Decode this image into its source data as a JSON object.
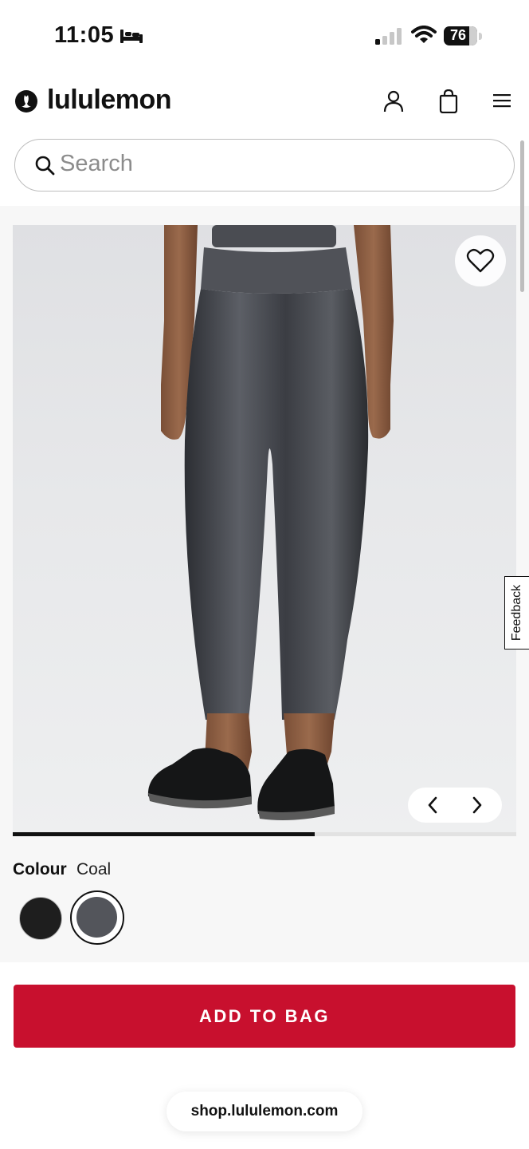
{
  "status_bar": {
    "time": "11:05",
    "battery_level": "76",
    "sleep_icon": "bed-icon",
    "signal_icon": "cellular-signal-icon",
    "wifi_icon": "wifi-icon"
  },
  "header": {
    "brand": "lululemon",
    "logo_icon": "lululemon-logo-icon",
    "account_icon": "account-icon",
    "bag_icon": "shopping-bag-icon",
    "menu_icon": "hamburger-menu-icon"
  },
  "search": {
    "placeholder": "Search",
    "icon": "search-icon"
  },
  "gallery": {
    "image_description": "product-image-leggings-back-view",
    "wishlist_icon": "heart-icon",
    "prev_icon": "chevron-left-icon",
    "next_icon": "chevron-right-icon",
    "progress": 0.6
  },
  "feedback": {
    "label": "Feedback"
  },
  "colour": {
    "label": "Colour",
    "selected": "Coal",
    "swatches": [
      {
        "name": "black-swatch",
        "hex": "#1e1e1e",
        "selected": false
      },
      {
        "name": "coal-swatch",
        "hex": "#53555b",
        "selected": true
      }
    ]
  },
  "cta": {
    "add_to_bag": "ADD TO BAG",
    "color": "#c8102e"
  },
  "browser": {
    "url": "shop.lululemon.com"
  }
}
